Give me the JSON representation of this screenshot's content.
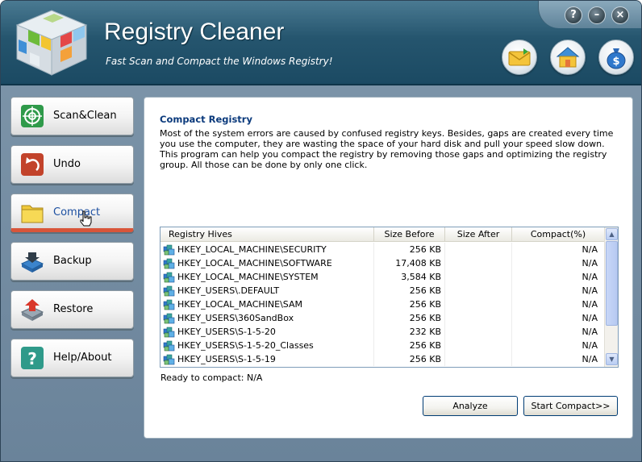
{
  "app": {
    "title": "Registry Cleaner",
    "subtitle": "Fast Scan and Compact the Windows Registry!"
  },
  "window_controls": {
    "help": "?",
    "minimize": "–",
    "close": "×"
  },
  "sidebar": {
    "items": [
      {
        "label": "Scan&Clean",
        "icon": "target-icon"
      },
      {
        "label": "Undo",
        "icon": "undo-arrow-icon"
      },
      {
        "label": "Compact",
        "icon": "folder-icon",
        "active": true
      },
      {
        "label": "Backup",
        "icon": "backup-tray-icon"
      },
      {
        "label": "Restore",
        "icon": "restore-tray-icon"
      },
      {
        "label": "Help/About",
        "icon": "question-icon"
      }
    ]
  },
  "panel": {
    "title": "Compact Registry",
    "description": "Most of the system errors are caused by confused registry keys. Besides, gaps are created every time you use the computer, they are wasting the space of your hard disk and pull your speed slow down. This program can help you compact the registry by removing those gaps and optimizing the registry group. All those can be done by only one click."
  },
  "table": {
    "columns": [
      "Registry Hives",
      "Size Before",
      "Size After",
      "Compact(%)"
    ],
    "rows": [
      {
        "hive": "HKEY_LOCAL_MACHINE\\SECURITY",
        "before": "256 KB",
        "after": "",
        "compact": "N/A"
      },
      {
        "hive": "HKEY_LOCAL_MACHINE\\SOFTWARE",
        "before": "17,408 KB",
        "after": "",
        "compact": "N/A"
      },
      {
        "hive": "HKEY_LOCAL_MACHINE\\SYSTEM",
        "before": "3,584 KB",
        "after": "",
        "compact": "N/A"
      },
      {
        "hive": "HKEY_USERS\\.DEFAULT",
        "before": "256 KB",
        "after": "",
        "compact": "N/A"
      },
      {
        "hive": "HKEY_LOCAL_MACHINE\\SAM",
        "before": "256 KB",
        "after": "",
        "compact": "N/A"
      },
      {
        "hive": "HKEY_USERS\\360SandBox",
        "before": "256 KB",
        "after": "",
        "compact": "N/A"
      },
      {
        "hive": "HKEY_USERS\\S-1-5-20",
        "before": "232 KB",
        "after": "",
        "compact": "N/A"
      },
      {
        "hive": "HKEY_USERS\\S-1-5-20_Classes",
        "before": "256 KB",
        "after": "",
        "compact": "N/A"
      },
      {
        "hive": "HKEY_USERS\\S-1-5-19",
        "before": "256 KB",
        "after": "",
        "compact": "N/A"
      }
    ]
  },
  "status": "Ready to compact: N/A",
  "buttons": {
    "analyze": "Analyze",
    "start": "Start Compact>>"
  },
  "colors": {
    "header": "#25556e",
    "title_blue": "#0b3a7c",
    "active_underline": "#d8553a"
  }
}
